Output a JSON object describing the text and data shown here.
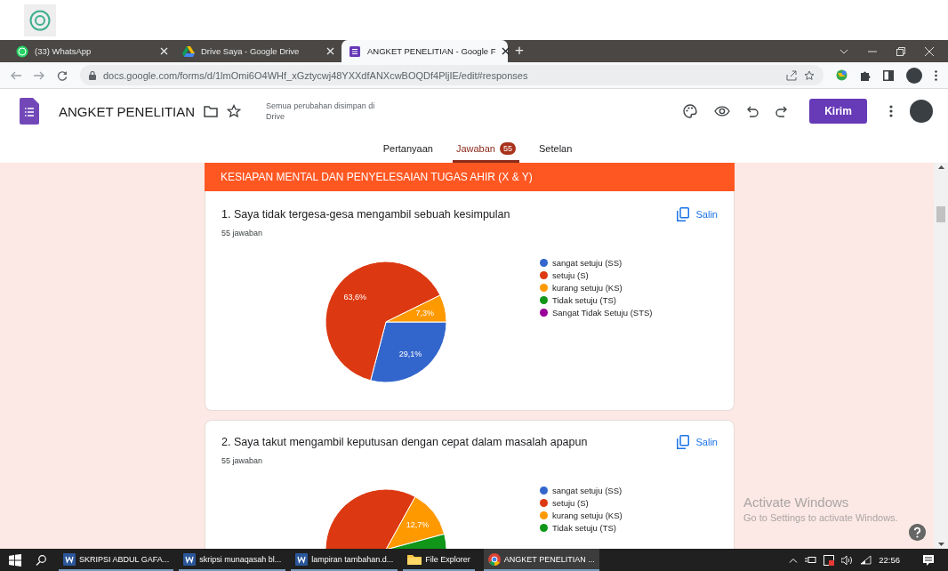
{
  "browser": {
    "tabs": [
      {
        "title": "(33) WhatsApp",
        "kind": "whatsapp",
        "selected": false
      },
      {
        "title": "Drive Saya - Google Drive",
        "kind": "drive",
        "selected": false
      },
      {
        "title": "ANGKET PENELITIAN - Google F",
        "kind": "forms",
        "selected": true
      }
    ],
    "new_tab": "+",
    "url": "docs.google.com/forms/d/1lmOmi6O4WHf_xGztycwj48YXXdfANXcwBOQDf4PljIE/edit#responses"
  },
  "form_header": {
    "title": "ANGKET PENELITIAN",
    "save_status": "Semua perubahan disimpan di Drive",
    "send_button": "Kirim"
  },
  "form_tabs": [
    {
      "label": "Pertanyaan",
      "selected": false
    },
    {
      "label": "Jawaban",
      "selected": true,
      "badge": "55"
    },
    {
      "label": "Setelan",
      "selected": false
    }
  ],
  "section_title": "KESIAPAN MENTAL DAN PENYELESAIAN TUGAS AHIR (X & Y)",
  "questions": [
    {
      "title": "1. Saya tidak tergesa-gesa mengambil sebuah kesimpulan",
      "copy_button": "Salin",
      "responses": "55 jawaban",
      "chart_data": {
        "type": "pie",
        "categories": [
          "sangat setuju (SS)",
          "setuju (S)",
          "kurang setuju (KS)",
          "Tidak setuju (TS)",
          "Sangat Tidak Setuju (STS)"
        ],
        "values": [
          29.1,
          63.6,
          7.3,
          0,
          0
        ],
        "colors": [
          "#3366cc",
          "#dc3912",
          "#ff9900",
          "#109618",
          "#990099"
        ],
        "value_labels": [
          "29,1%",
          "63,6%",
          "7,3%",
          null,
          null
        ]
      }
    },
    {
      "title": "2. Saya takut mengambil keputusan dengan cepat dalam masalah apapun",
      "copy_button": "Salin",
      "responses": "55 jawaban",
      "pie_label": "12,7%",
      "legend": [
        {
          "label": "sangat setuju (SS)",
          "color": "#3366cc"
        },
        {
          "label": "setuju (S)",
          "color": "#dc3912"
        },
        {
          "label": "kurang setuju (KS)",
          "color": "#ff9900"
        },
        {
          "label": "Tidak setuju (TS)",
          "color": "#109618"
        }
      ]
    }
  ],
  "activation_notice": {
    "title": "Activate Windows",
    "subtitle": "Go to Settings to activate Windows."
  },
  "taskbar": {
    "apps": [
      {
        "label": "SKRIPSI ABDUL GAFA...",
        "kind": "word",
        "selected": false
      },
      {
        "label": "skripsi munaqasah bl...",
        "kind": "word",
        "selected": false
      },
      {
        "label": "lampiran tambahan.d...",
        "kind": "word",
        "selected": false
      },
      {
        "label": "File Explorer",
        "kind": "folder",
        "selected": false
      },
      {
        "label": "ANGKET PENELITIAN ...",
        "kind": "chrome",
        "selected": true
      }
    ],
    "clock": "22:56"
  }
}
